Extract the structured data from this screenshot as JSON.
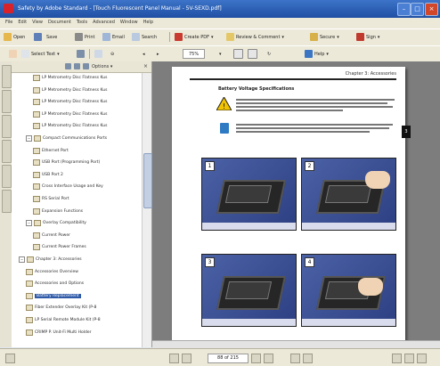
{
  "window": {
    "title": "Safety by Adobe Standard - [Touch Fluorescent Panel Manual - 5V-SEXD.pdf]"
  },
  "menu": [
    "File",
    "Edit",
    "View",
    "Document",
    "Tools",
    "Advanced",
    "Window",
    "Help"
  ],
  "toolbar1": {
    "open": "Open",
    "save": "Save",
    "print": "Print",
    "email": "Email",
    "search": "Search",
    "create_pdf": "Create PDF",
    "review": "Review & Comment",
    "secure": "Secure",
    "sign": "Sign"
  },
  "toolbar2": {
    "select_text": "Select Text",
    "zoom_value": "75%",
    "help": "Help"
  },
  "nav": {
    "options_label": "Options",
    "items": [
      {
        "label": "LP Metrometry Disc Flatness Kus",
        "level": 2,
        "expander": "",
        "selected": false
      },
      {
        "label": "LP Metrometry Disc Flatness Kus",
        "level": 2,
        "expander": "",
        "selected": false
      },
      {
        "label": "LP Metrometry Disc Flatness Kus",
        "level": 2,
        "expander": "",
        "selected": false
      },
      {
        "label": "LP Metrometry Disc Flatness Kus",
        "level": 2,
        "expander": "",
        "selected": false
      },
      {
        "label": "LP Metrometry Disc Flatness Kus",
        "level": 2,
        "expander": "",
        "selected": false
      },
      {
        "label": "Compact Communications Ports",
        "level": 1,
        "expander": "−",
        "selected": false
      },
      {
        "label": "Ethernet Port",
        "level": 2,
        "expander": "",
        "selected": false
      },
      {
        "label": "USB Port (Programming Port)",
        "level": 2,
        "expander": "",
        "selected": false
      },
      {
        "label": "USB Port 2",
        "level": 2,
        "expander": "",
        "selected": false
      },
      {
        "label": "Cross Interface Usage and Key",
        "level": 2,
        "expander": "",
        "selected": false
      },
      {
        "label": "RS Serial Port",
        "level": 2,
        "expander": "",
        "selected": false
      },
      {
        "label": "Expansion Functions",
        "level": 2,
        "expander": "",
        "selected": false
      },
      {
        "label": "Overlay Compatibility",
        "level": 1,
        "expander": "−",
        "selected": false
      },
      {
        "label": "Current Power",
        "level": 2,
        "expander": "",
        "selected": false
      },
      {
        "label": "Current Power Frames",
        "level": 2,
        "expander": "",
        "selected": false
      },
      {
        "label": "Chapter 3: Accessories",
        "level": 0,
        "expander": "−",
        "selected": false
      },
      {
        "label": "Accessories Overview",
        "level": 1,
        "expander": "",
        "selected": false
      },
      {
        "label": "Accessories and Options",
        "level": 1,
        "expander": "",
        "selected": false
      },
      {
        "label": "Battery Replacement",
        "level": 1,
        "expander": "",
        "selected": true
      },
      {
        "label": "Fiber Extender Overlay Kit (P-8",
        "level": 1,
        "expander": "",
        "selected": false
      },
      {
        "label": "LP Serial Remote Module Kit (P-8",
        "level": 1,
        "expander": "",
        "selected": false
      },
      {
        "label": "CRIMP P. Unit-Fi Multi Holder",
        "level": 1,
        "expander": "",
        "selected": false
      }
    ]
  },
  "page": {
    "header": "Chapter 3: Accessories",
    "section_title": "Battery Voltage Specifications",
    "tab_number": "3",
    "photos": [
      "1",
      "2",
      "3",
      "4"
    ]
  },
  "status": {
    "page_indicator": "88 of 215"
  }
}
